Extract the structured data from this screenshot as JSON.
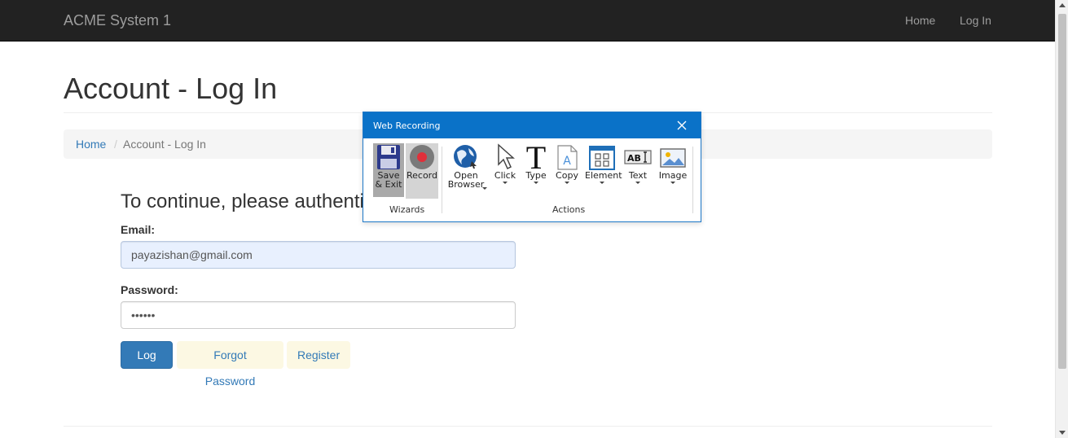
{
  "navbar": {
    "brand": "ACME System 1",
    "links": [
      "Home",
      "Log In"
    ]
  },
  "page": {
    "title": "Account - Log In",
    "breadcrumb": {
      "home": "Home",
      "separator": "/",
      "current": "Account - Log In"
    },
    "subtitle": "To continue, please authenti",
    "email": {
      "label": "Email:",
      "value": "payazishan@gmail.com"
    },
    "password": {
      "label": "Password:",
      "value": "••••••"
    },
    "buttons": {
      "login": "Log In",
      "forgot": "Forgot Password",
      "register": "Register"
    }
  },
  "recorder": {
    "title": "Web Recording",
    "tools": {
      "save": [
        "Save",
        "& Exit"
      ],
      "record": "Record",
      "open_browser": [
        "Open",
        "Browser"
      ],
      "click": "Click",
      "type": "Type",
      "copy": "Copy",
      "element": "Element",
      "text": "Text",
      "image": "Image"
    },
    "groups": {
      "wizards": "Wizards",
      "actions": "Actions"
    }
  },
  "colors": {
    "navbar_bg": "#222222",
    "primary": "#337ab7",
    "recorder_title_bg": "#0a72c8",
    "record_dot": "#e0303a"
  }
}
